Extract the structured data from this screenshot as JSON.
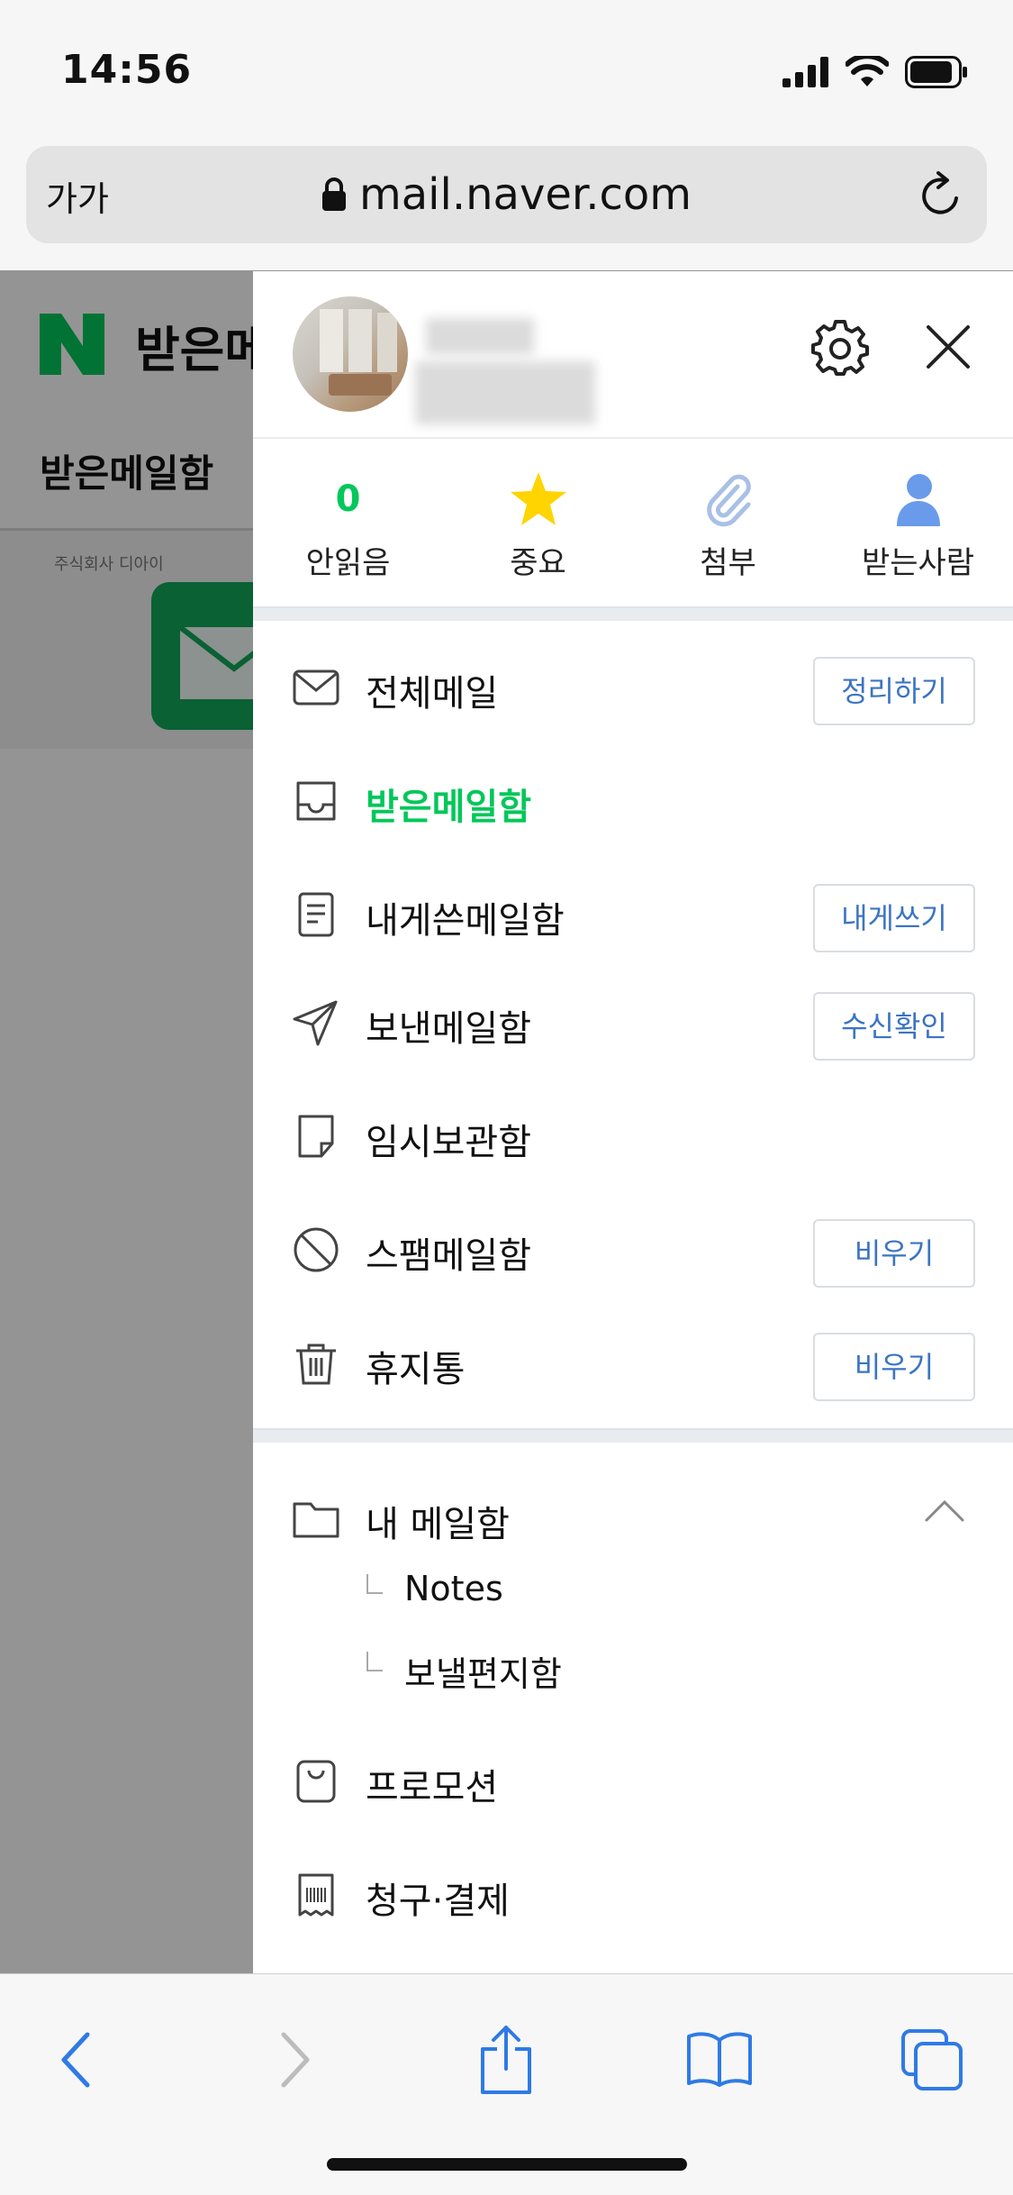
{
  "status": {
    "time": "14:56"
  },
  "browser": {
    "text_size_label": "가가",
    "url": "mail.naver.com"
  },
  "background_page": {
    "logo_letter": "N",
    "title": "받은메",
    "tab": "받은메일함",
    "ad_label": "주식회사 디아이"
  },
  "colors": {
    "accent_green": "#03c75a",
    "button_blue": "#3b74c2",
    "star_yellow": "#ffd400",
    "person_blue": "#6a9bea"
  },
  "quick_access": [
    {
      "count": "0",
      "label": "안읽음",
      "icon": "unread-count"
    },
    {
      "label": "중요",
      "icon": "star-icon"
    },
    {
      "label": "첨부",
      "icon": "paperclip-icon"
    },
    {
      "label": "받는사람",
      "icon": "person-icon"
    }
  ],
  "mailboxes": [
    {
      "label": "전체메일",
      "icon": "envelope-icon",
      "button": "정리하기"
    },
    {
      "label": "받은메일함",
      "icon": "inbox-tray-icon",
      "active": true
    },
    {
      "label": "내게쓴메일함",
      "icon": "document-icon",
      "button": "내게쓰기"
    },
    {
      "label": "보낸메일함",
      "icon": "paper-plane-icon",
      "button": "수신확인"
    },
    {
      "label": "임시보관함",
      "icon": "draft-note-icon"
    },
    {
      "label": "스팸메일함",
      "icon": "block-icon",
      "button": "비우기"
    },
    {
      "label": "휴지통",
      "icon": "trash-icon",
      "button": "비우기"
    }
  ],
  "my_mailbox": {
    "label": "내 메일함",
    "icon": "folder-icon",
    "children": [
      "Notes",
      "보낼편지함"
    ]
  },
  "extras": [
    {
      "label": "프로모션",
      "icon": "shopping-bag-icon"
    },
    {
      "label": "청구·결제",
      "icon": "receipt-icon"
    }
  ]
}
